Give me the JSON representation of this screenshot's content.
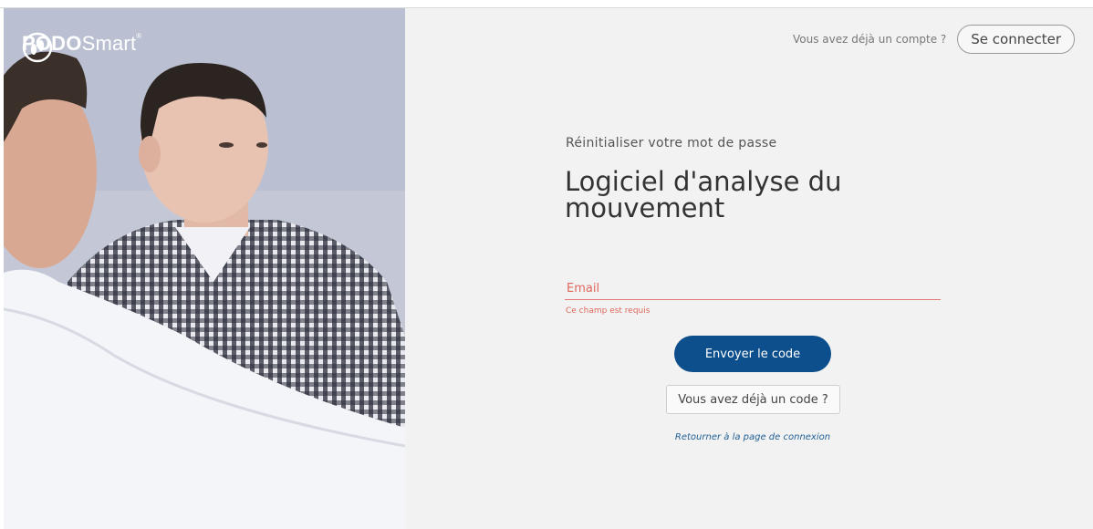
{
  "brand": {
    "name_bold": "PODO",
    "name_regular": "Smart",
    "trademark": "®"
  },
  "header": {
    "account_prompt": "Vous avez déjà un compte ?",
    "login_label": "Se connecter"
  },
  "form": {
    "subtitle": "Réinitialiser votre mot de passe",
    "title": "Logiciel d'analyse du mouvement",
    "email_placeholder": "Email",
    "email_error": "Ce champ est requis",
    "send_code_label": "Envoyer le code",
    "have_code_label": "Vous avez déjà un code ?",
    "back_link_label": "Retourner à la page de connexion"
  },
  "colors": {
    "primary": "#0d4f8c",
    "error": "#e0675c",
    "link": "#1f5f96",
    "panel_bg": "#f2f2f2"
  }
}
